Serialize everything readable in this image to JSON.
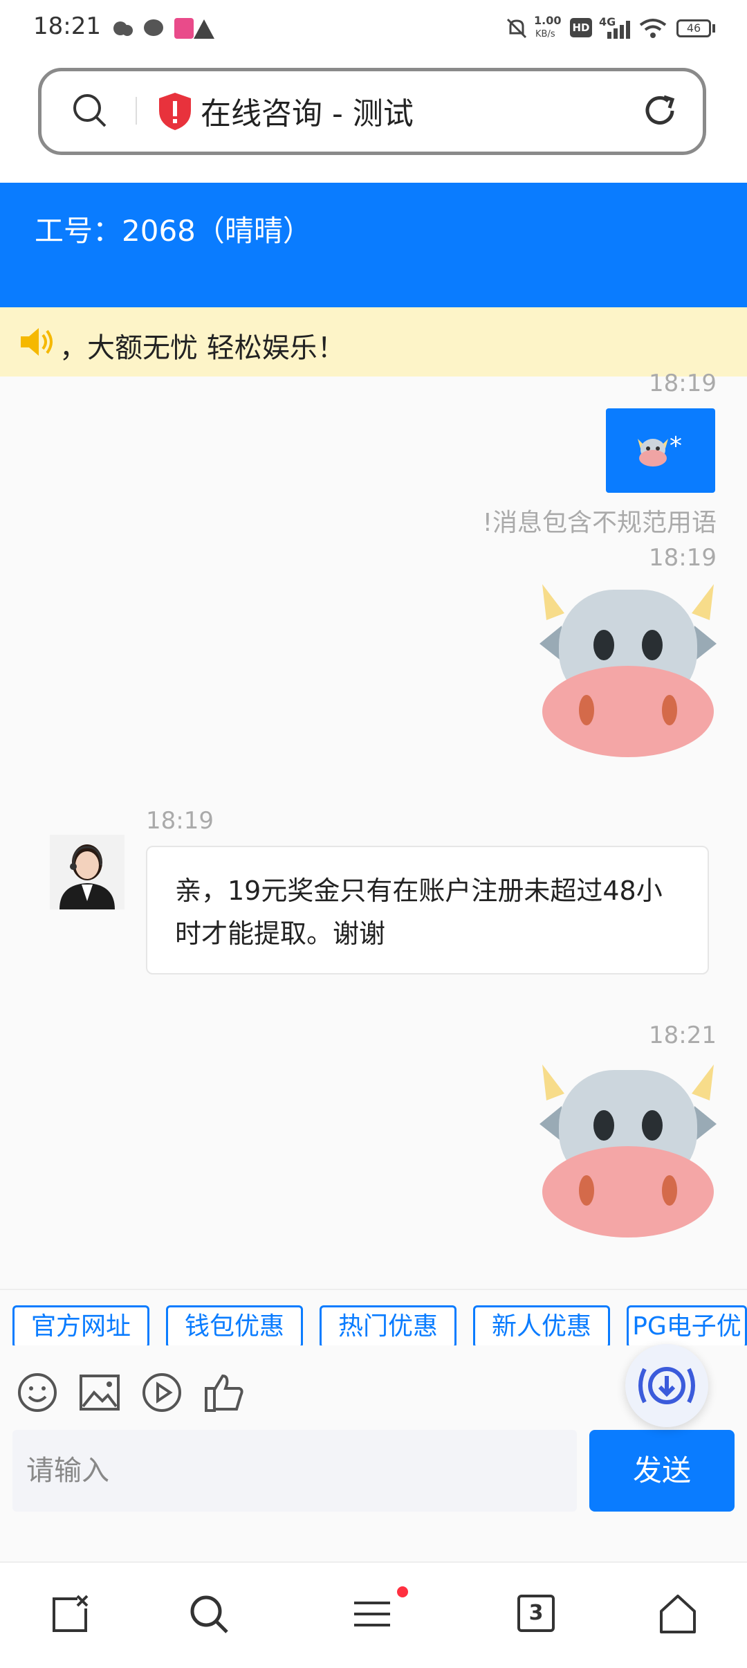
{
  "status_bar": {
    "time": "18:21",
    "net_speed": "1.00",
    "net_unit": "KB/s",
    "hd_badge": "HD",
    "network": "4G",
    "battery": "46"
  },
  "browser": {
    "title": "在线咨询 - 测试"
  },
  "header": {
    "agent_label": "工号：2068（晴晴）"
  },
  "notice": {
    "text": "，大额无忧 轻松娱乐！"
  },
  "messages": {
    "m1_time": "18:19",
    "m1_text": "*",
    "m1_status": "!消息包含不规范用语",
    "m2_time": "18:19",
    "m3_time": "18:19",
    "m3_text": "亲，19元奖金只有在账户注册未超过48小时才能提取。谢谢",
    "m4_time": "18:21"
  },
  "quick_replies": [
    "官方网址",
    "钱包优惠",
    "热门优惠",
    "新人优惠",
    "PG电子优"
  ],
  "composer": {
    "placeholder": "请输入",
    "send_label": "发送"
  },
  "nav": {
    "tabs_count": "3"
  },
  "colors": {
    "primary": "#0a7cff",
    "notice_bg": "#fdf4c8"
  }
}
